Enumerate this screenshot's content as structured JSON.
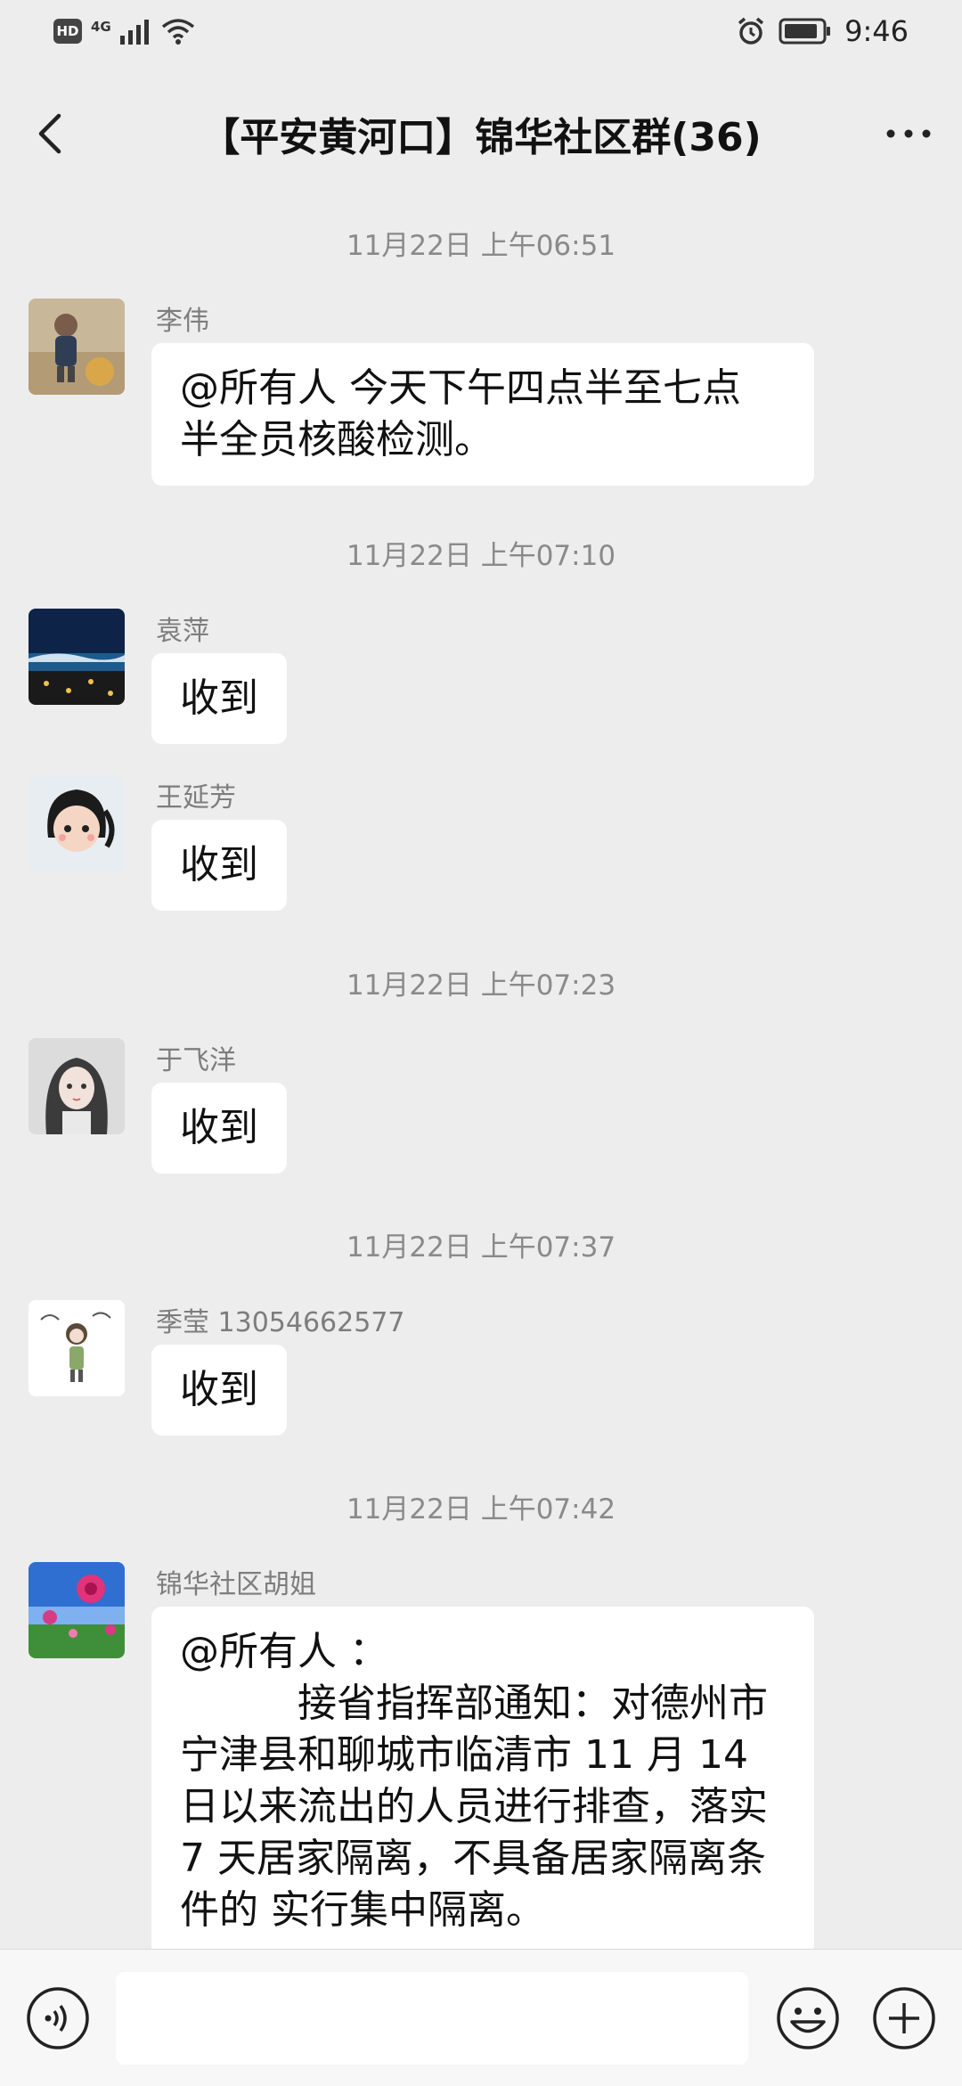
{
  "status_bar": {
    "time": "9:46",
    "hd": "HD",
    "network": "4G"
  },
  "header": {
    "title": "【平安黄河口】锦华社区群(36)"
  },
  "messages": [
    {
      "timestamp": "11月22日 上午06:51",
      "sender": "李伟",
      "lines": [
        "@所有人  今天下午四点半至七点",
        "半全员核酸检测。"
      ]
    },
    {
      "timestamp": "11月22日 上午07:10",
      "sender": "袁萍",
      "text": "收到"
    },
    {
      "sender": "王延芳",
      "text": "收到"
    },
    {
      "timestamp": "11月22日 上午07:23",
      "sender": "于飞洋",
      "text": "收到"
    },
    {
      "timestamp": "11月22日 上午07:37",
      "sender": "季莹 13054662577",
      "text": "收到"
    },
    {
      "timestamp": "11月22日 上午07:42",
      "sender": "锦华社区胡姐",
      "lines": [
        "@所有人 ：",
        "接省指挥部通知：对德州市宁津县和聊城市临清市 11 月 14 日以来流出的人员进行排查，落实 7 天居家隔离，不具备居家隔离条件的 实行集中隔离。"
      ]
    }
  ],
  "input_bar": {
    "placeholder": ""
  },
  "icons": {
    "back": "chevron-left-icon",
    "more": "more-dots-icon",
    "voice": "voice-icon",
    "emoji": "emoji-icon",
    "plus": "plus-icon",
    "alarm": "alarm-icon",
    "battery": "battery-icon",
    "wifi": "wifi-icon",
    "signal": "signal-icon"
  },
  "colors": {
    "background": "#ededed",
    "bubble": "#ffffff",
    "timestamp": "#8a8a8a"
  }
}
